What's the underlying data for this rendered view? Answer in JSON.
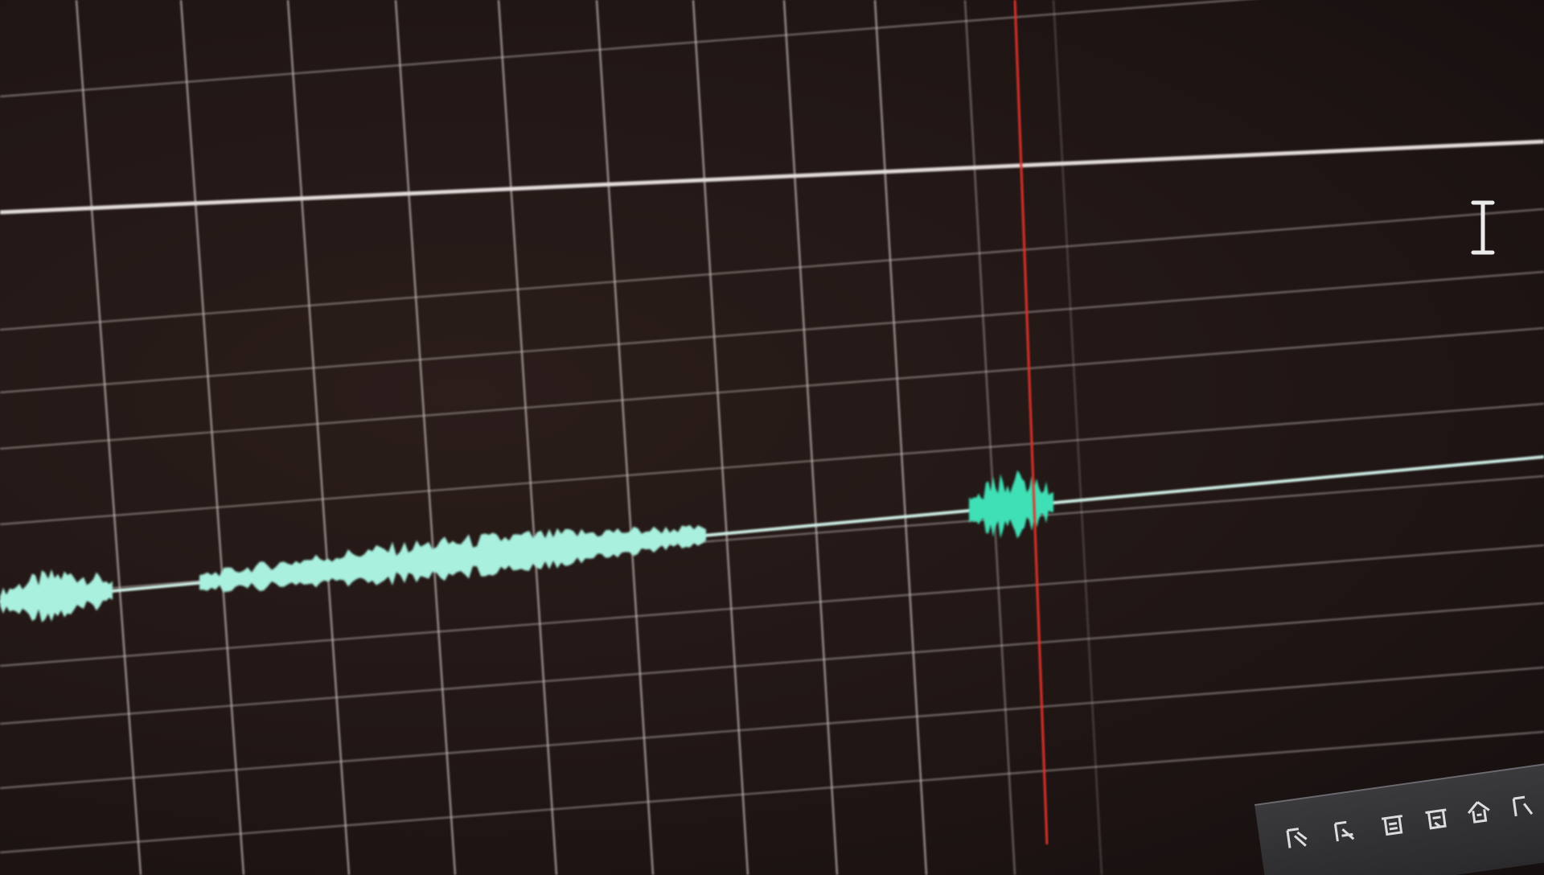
{
  "colors": {
    "background": "#221716",
    "grid": "#bcb3b0",
    "track_divider": "#e2dcda",
    "playhead": "#e0322b",
    "waveform": "#a9f0de",
    "waveform_selected": "#3fe0b6"
  },
  "editor": {
    "playhead_icon": "playhead-line",
    "cursor_icon": "text-ibeam-cursor"
  },
  "toolbar": {
    "icons": [
      "tool-icon-1",
      "tool-icon-2",
      "tool-icon-3",
      "tool-icon-4",
      "tool-icon-5"
    ]
  }
}
